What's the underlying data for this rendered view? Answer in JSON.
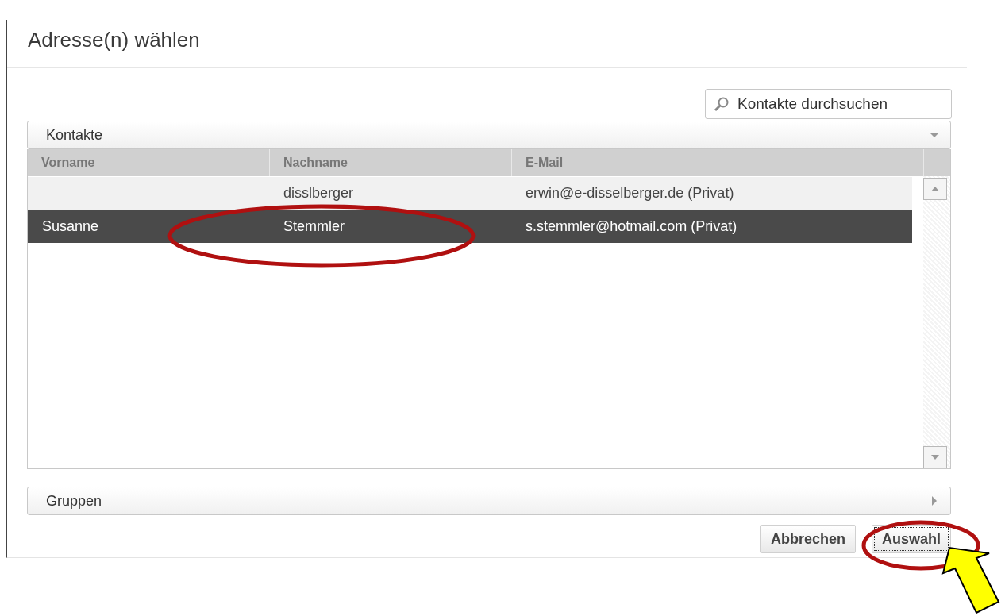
{
  "dialog": {
    "title": "Adresse(n) wählen"
  },
  "search": {
    "placeholder": "Kontakte durchsuchen"
  },
  "contacts_panel": {
    "title": "Kontakte",
    "expanded": true
  },
  "table": {
    "columns": [
      "Vorname",
      "Nachname",
      "E-Mail"
    ],
    "rows": [
      {
        "cells": [
          "",
          "disslberger",
          "erwin@e-disselberger.de (Privat)"
        ],
        "selected": false
      },
      {
        "cells": [
          "Susanne",
          "Stemmler",
          "s.stemmler@hotmail.com (Privat)"
        ],
        "selected": true
      }
    ]
  },
  "groups_panel": {
    "title": "Gruppen",
    "expanded": false
  },
  "buttons": [
    {
      "label": "Abbrechen",
      "focused": false
    },
    {
      "label": "Auswahl",
      "focused": true
    }
  ]
}
